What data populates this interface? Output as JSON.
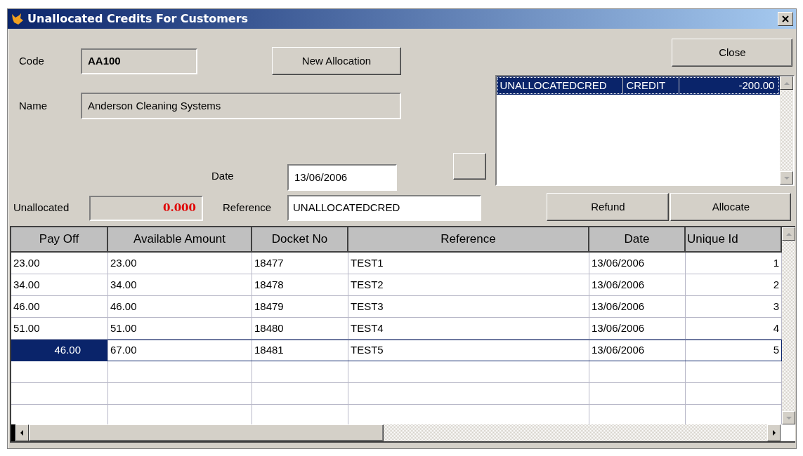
{
  "window": {
    "title": "Unallocated Credits For Customers"
  },
  "form": {
    "code": {
      "label": "Code",
      "value": "AA100"
    },
    "name": {
      "label": "Name",
      "value": "Anderson Cleaning Systems"
    },
    "date": {
      "label": "Date",
      "value": "13/06/2006"
    },
    "unallocated": {
      "label": "Unallocated",
      "value": "0.000"
    },
    "reference": {
      "label": "Reference",
      "value": "UNALLOCATEDCRED"
    }
  },
  "buttons": {
    "new_allocation": "New Allocation",
    "close": "Close",
    "refund": "Refund",
    "allocate": "Allocate"
  },
  "credits_list": {
    "rows": [
      {
        "cells": [
          "UNALLOCATEDCRED",
          "CREDIT",
          "-200.00"
        ],
        "selected": true
      }
    ]
  },
  "grid": {
    "columns": [
      "Pay Off",
      "Available Amount",
      "Docket No",
      "Reference",
      "Date",
      "Unique Id"
    ],
    "rows": [
      {
        "cells": [
          "23.00",
          "23.00",
          "18477",
          "TEST1",
          "13/06/2006",
          "1"
        ],
        "selected": false
      },
      {
        "cells": [
          "34.00",
          "34.00",
          "18478",
          "TEST2",
          "13/06/2006",
          "2"
        ],
        "selected": false
      },
      {
        "cells": [
          "46.00",
          "46.00",
          "18479",
          "TEST3",
          "13/06/2006",
          "3"
        ],
        "selected": false
      },
      {
        "cells": [
          "51.00",
          "51.00",
          "18480",
          "TEST4",
          "13/06/2006",
          "4"
        ],
        "selected": false
      },
      {
        "cells": [
          "46.00",
          "67.00",
          "18481",
          "TEST5",
          "13/06/2006",
          "5"
        ],
        "selected": true
      }
    ]
  }
}
